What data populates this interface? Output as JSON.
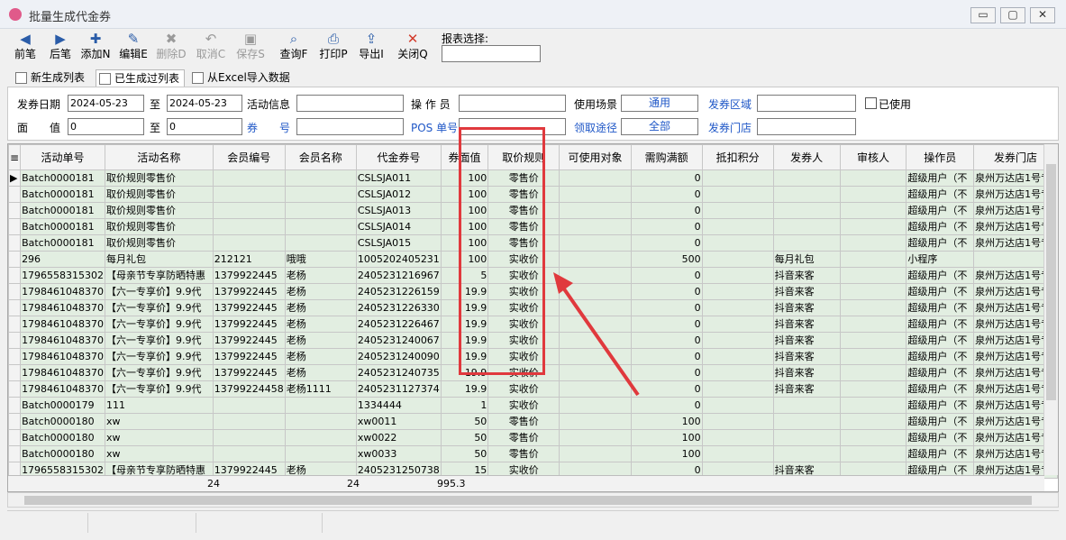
{
  "window": {
    "title": "批量生成代金券",
    "controls": [
      "▭",
      "▢",
      "✕"
    ]
  },
  "toolbar": [
    {
      "icon": "arrow-left-icon",
      "glyph": "◀",
      "label": "前笔",
      "enabled": true
    },
    {
      "icon": "arrow-right-icon",
      "glyph": "▶",
      "label": "后笔",
      "enabled": true
    },
    {
      "icon": "add-doc-icon",
      "glyph": "✚",
      "label": "添加N",
      "enabled": true
    },
    {
      "icon": "edit-doc-icon",
      "glyph": "✎",
      "label": "编辑E",
      "enabled": true
    },
    {
      "icon": "delete-doc-icon",
      "glyph": "✖",
      "label": "删除D",
      "enabled": false
    },
    {
      "icon": "undo-icon",
      "glyph": "↶",
      "label": "取消C",
      "enabled": false
    },
    {
      "icon": "save-icon",
      "glyph": "▣",
      "label": "保存S",
      "enabled": false
    },
    {
      "icon": "query-icon",
      "glyph": "⌕",
      "label": "查询F",
      "enabled": true
    },
    {
      "icon": "print-icon",
      "glyph": "⎙",
      "label": "打印P",
      "enabled": true
    },
    {
      "icon": "export-icon",
      "glyph": "⇪",
      "label": "导出I",
      "enabled": true
    },
    {
      "icon": "close-icon",
      "glyph": "✕",
      "label": "关闭Q",
      "enabled": true
    }
  ],
  "report": {
    "label": "报表选择:",
    "value": ""
  },
  "tabs": [
    {
      "label": "新生成列表",
      "active": false
    },
    {
      "label": "已生成过列表",
      "active": true
    },
    {
      "label": "从Excel导入数据",
      "active": false
    }
  ],
  "filters": {
    "issue_date_label": "发券日期",
    "date_from": "2024-05-23",
    "to1": "至",
    "date_to": "2024-05-23",
    "activity_info_label": "活动信息",
    "activity_info": "",
    "operator_label": "操 作 员",
    "operator": "",
    "scene_label": "使用场景",
    "scene": "通用",
    "region_label": "发券区域",
    "region": "",
    "used_label": "已使用",
    "face_label": "面　　值",
    "face_from": "0",
    "to2": "至",
    "face_to": "0",
    "voucher_no_label": "券　　号",
    "voucher_no": "",
    "pos_label": "POS 单号",
    "pos_no": "",
    "channel_label": "领取途径",
    "channel": "全部",
    "store_label": "发券门店",
    "store": ""
  },
  "grid": {
    "columns": [
      "活动单号",
      "活动名称",
      "会员编号",
      "会员名称",
      "代金券号",
      "券面值",
      "取价规则",
      "可使用对象",
      "需购满额",
      "抵扣积分",
      "发券人",
      "审核人",
      "操作员",
      "发券门店"
    ],
    "rows": [
      [
        "Batch0000181",
        "取价规则零售价",
        "",
        "",
        "CSLSJA011",
        "100",
        "零售价",
        "",
        "0",
        "",
        "",
        "",
        "超级用户（不",
        "泉州万达店1号专"
      ],
      [
        "Batch0000181",
        "取价规则零售价",
        "",
        "",
        "CSLSJA012",
        "100",
        "零售价",
        "",
        "0",
        "",
        "",
        "",
        "超级用户（不",
        "泉州万达店1号专"
      ],
      [
        "Batch0000181",
        "取价规则零售价",
        "",
        "",
        "CSLSJA013",
        "100",
        "零售价",
        "",
        "0",
        "",
        "",
        "",
        "超级用户（不",
        "泉州万达店1号专"
      ],
      [
        "Batch0000181",
        "取价规则零售价",
        "",
        "",
        "CSLSJA014",
        "100",
        "零售价",
        "",
        "0",
        "",
        "",
        "",
        "超级用户（不",
        "泉州万达店1号专"
      ],
      [
        "Batch0000181",
        "取价规则零售价",
        "",
        "",
        "CSLSJA015",
        "100",
        "零售价",
        "",
        "0",
        "",
        "",
        "",
        "超级用户（不",
        "泉州万达店1号专"
      ],
      [
        "296",
        "每月礼包",
        "212121",
        "哦哦",
        "1005202405231",
        "100",
        "实收价",
        "",
        "500",
        "",
        "每月礼包",
        "",
        "小程序",
        ""
      ],
      [
        "1796558315302",
        "【母亲节专享防晒特惠",
        "1379922445",
        "老杨",
        "2405231216967",
        "5",
        "实收价",
        "",
        "0",
        "",
        "抖音来客",
        "",
        "超级用户（不",
        "泉州万达店1号专"
      ],
      [
        "1798461048370",
        "【六一专享价】9.9代",
        "1379922445",
        "老杨",
        "2405231226159",
        "19.9",
        "实收价",
        "",
        "0",
        "",
        "抖音来客",
        "",
        "超级用户（不",
        "泉州万达店1号专"
      ],
      [
        "1798461048370",
        "【六一专享价】9.9代",
        "1379922445",
        "老杨",
        "2405231226330",
        "19.9",
        "实收价",
        "",
        "0",
        "",
        "抖音来客",
        "",
        "超级用户（不",
        "泉州万达店1号专"
      ],
      [
        "1798461048370",
        "【六一专享价】9.9代",
        "1379922445",
        "老杨",
        "2405231226467",
        "19.9",
        "实收价",
        "",
        "0",
        "",
        "抖音来客",
        "",
        "超级用户（不",
        "泉州万达店1号专"
      ],
      [
        "1798461048370",
        "【六一专享价】9.9代",
        "1379922445",
        "老杨",
        "2405231240067",
        "19.9",
        "实收价",
        "",
        "0",
        "",
        "抖音来客",
        "",
        "超级用户（不",
        "泉州万达店1号专"
      ],
      [
        "1798461048370",
        "【六一专享价】9.9代",
        "1379922445",
        "老杨",
        "2405231240090",
        "19.9",
        "实收价",
        "",
        "0",
        "",
        "抖音来客",
        "",
        "超级用户（不",
        "泉州万达店1号专"
      ],
      [
        "1798461048370",
        "【六一专享价】9.9代",
        "1379922445",
        "老杨",
        "2405231240735",
        "19.9",
        "实收价",
        "",
        "0",
        "",
        "抖音来客",
        "",
        "超级用户（不",
        "泉州万达店1号专"
      ],
      [
        "1798461048370",
        "【六一专享价】9.9代",
        "13799224458",
        "老杨1111",
        "2405231127374",
        "19.9",
        "实收价",
        "",
        "0",
        "",
        "抖音来客",
        "",
        "超级用户（不",
        "泉州万达店1号专"
      ],
      [
        "Batch0000179",
        "111",
        "",
        "",
        "1334444",
        "1",
        "实收价",
        "",
        "0",
        "",
        "",
        "",
        "超级用户（不",
        "泉州万达店1号专"
      ],
      [
        "Batch0000180",
        "xw",
        "",
        "",
        "xw0011",
        "50",
        "零售价",
        "",
        "100",
        "",
        "",
        "",
        "超级用户（不",
        "泉州万达店1号专"
      ],
      [
        "Batch0000180",
        "xw",
        "",
        "",
        "xw0022",
        "50",
        "零售价",
        "",
        "100",
        "",
        "",
        "",
        "超级用户（不",
        "泉州万达店1号专"
      ],
      [
        "Batch0000180",
        "xw",
        "",
        "",
        "xw0033",
        "50",
        "零售价",
        "",
        "100",
        "",
        "",
        "",
        "超级用户（不",
        "泉州万达店1号专"
      ],
      [
        "1796558315302",
        "【母亲节专享防晒特惠",
        "1379922445",
        "老杨",
        "2405231250738",
        "15",
        "实收价",
        "",
        "0",
        "",
        "抖音来客",
        "",
        "超级用户（不",
        "泉州万达店1号专"
      ]
    ],
    "footer": {
      "member_count": "24",
      "voucher_count": "24",
      "face_total": "995.3"
    }
  }
}
